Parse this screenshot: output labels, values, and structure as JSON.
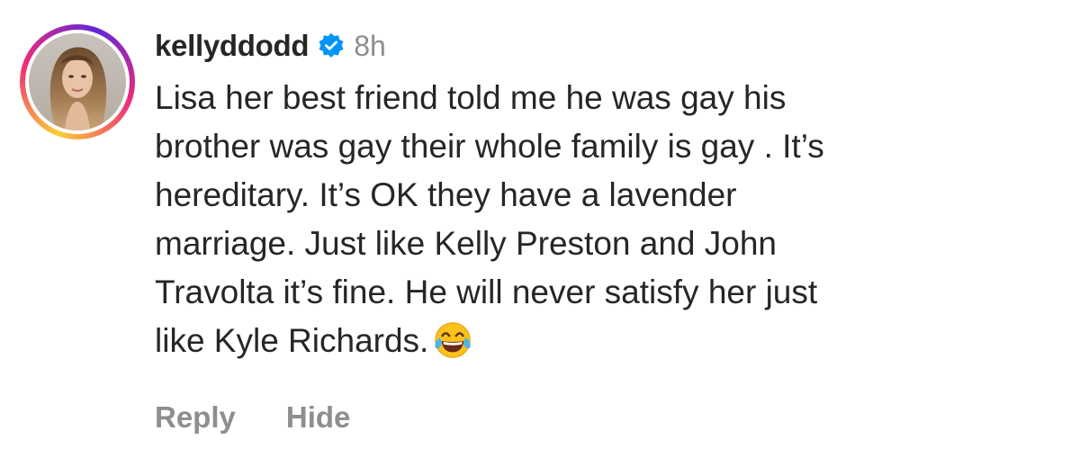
{
  "comment": {
    "username": "kellyddodd",
    "verified": true,
    "timestamp": "8h",
    "text_lines": [
      "Lisa her best friend told me he was gay his",
      "brother was gay their whole family is gay . It’s",
      "hereditary. It’s OK they have a lavender",
      "marriage. Just like Kelly Preston and John",
      "Travolta it’s fine. He will never satisfy her just",
      "like Kyle Richards."
    ],
    "emoji": "face-with-tears-of-joy-icon"
  },
  "actions": {
    "reply_label": "Reply",
    "hide_label": "Hide"
  },
  "colors": {
    "verified_blue": "#0095f6",
    "secondary_text": "#8e8e8e",
    "primary_text": "#262626"
  }
}
